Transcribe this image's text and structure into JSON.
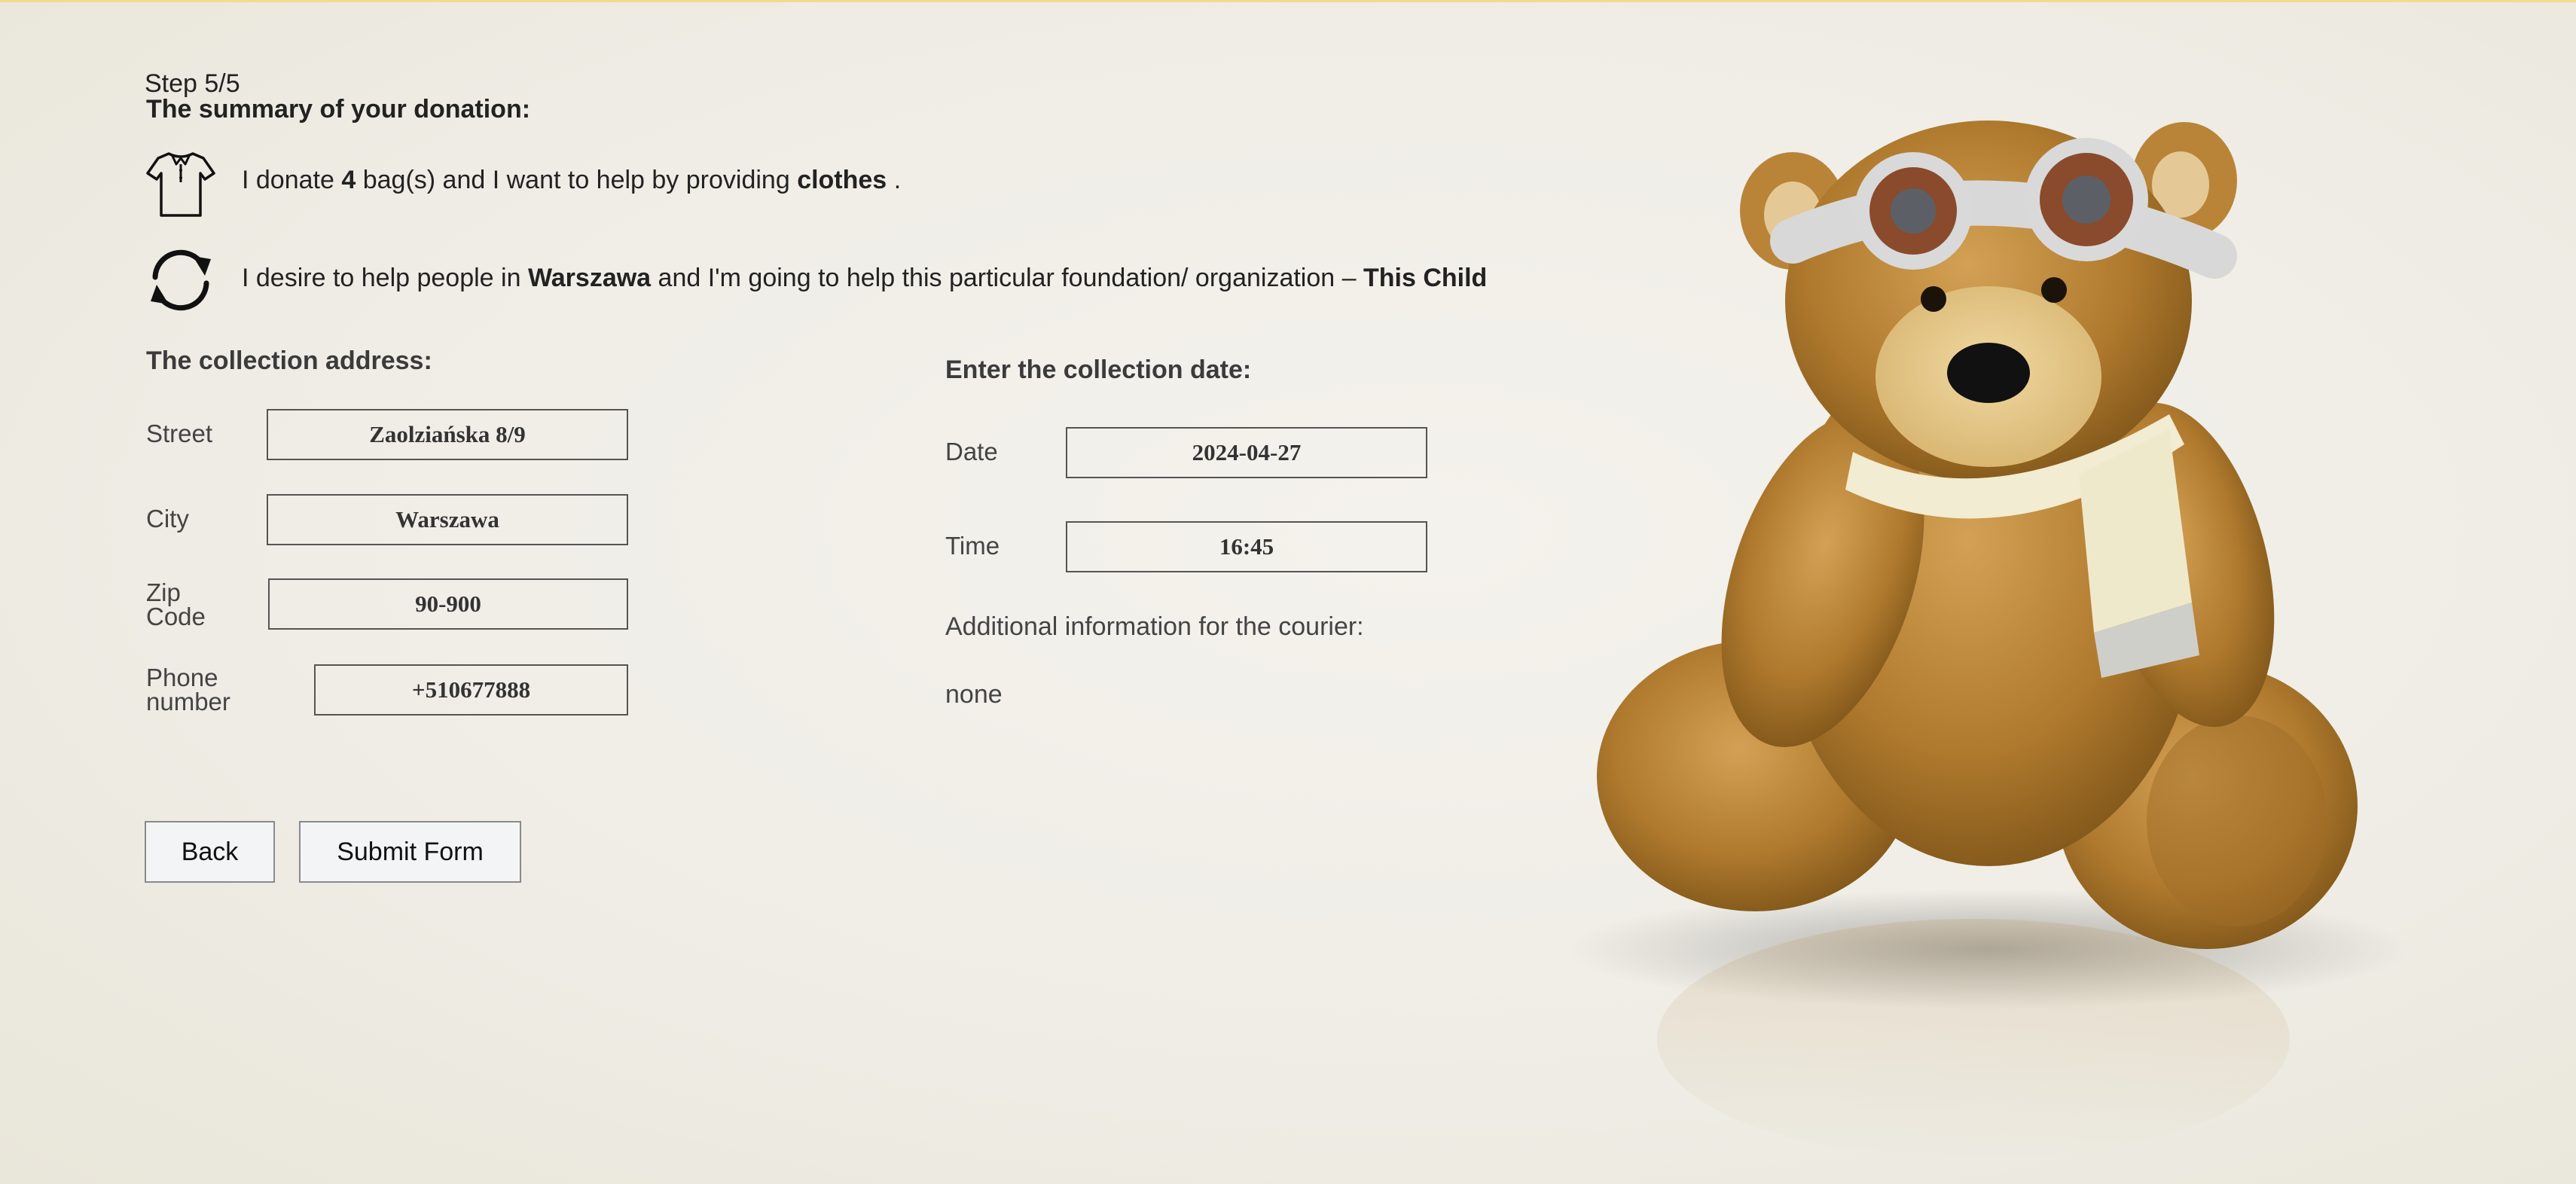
{
  "step": "Step 5/5",
  "summary_title": "The summary of your donation:",
  "summary": {
    "donate": {
      "icon": "shirt-icon",
      "pre": "I donate",
      "bags": "4",
      "mid": "bag(s) and I want to help by providing",
      "item": "clothes",
      "post": "."
    },
    "location": {
      "icon": "refresh-icon",
      "pre": "I desire to help people in",
      "city": "Warszawa",
      "mid": "and I'm going to help this particular foundation/ organization –",
      "org": "This Child"
    }
  },
  "address": {
    "title": "The collection address:",
    "street": {
      "label": "Street",
      "value": "Zaolziańska 8/9"
    },
    "city": {
      "label": "City",
      "value": "Warszawa"
    },
    "zip": {
      "label_line1": "Zip",
      "label_line2": "Code",
      "value": "90-900"
    },
    "phone": {
      "label_line1": "Phone",
      "label_line2": "number",
      "value": "+510677888"
    }
  },
  "collection": {
    "title": "Enter the collection date:",
    "date": {
      "label": "Date",
      "value": "2024-04-27"
    },
    "time": {
      "label": "Time",
      "value": "16:45"
    },
    "info_label": "Additional information for the courier:",
    "info_value": "none"
  },
  "buttons": {
    "back": "Back",
    "submit": "Submit Form"
  },
  "image": {
    "icon": "teddy-bear-illustration"
  },
  "colors": {
    "accent_line": "#f2dc8c",
    "background": "#efede6"
  }
}
